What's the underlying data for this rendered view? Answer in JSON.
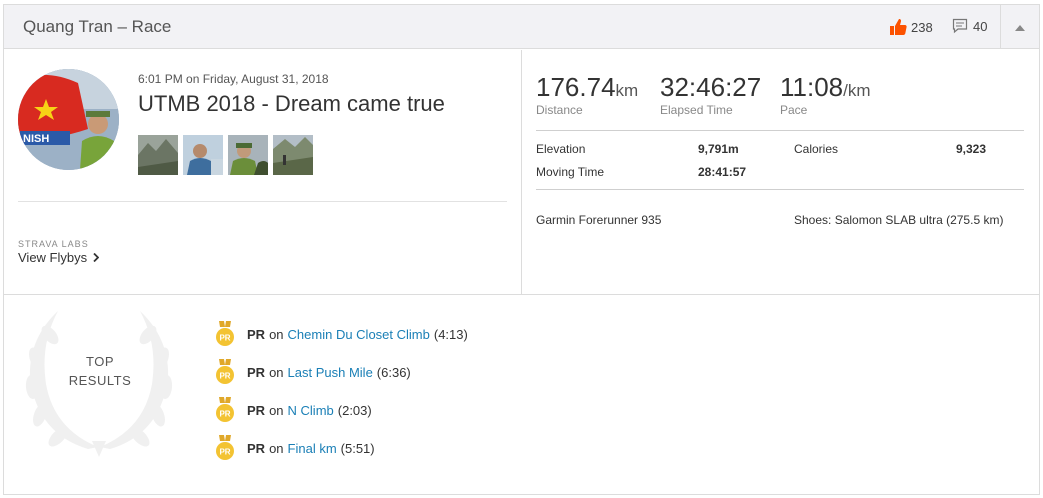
{
  "header": {
    "title": "Quang Tran – Race",
    "kudos_count": "238",
    "comments_count": "40"
  },
  "activity": {
    "datetime": "6:01 PM on Friday, August 31, 2018",
    "title": "UTMB 2018 - Dream came true",
    "labs_label": "STRAVA LABS",
    "flybys_label": "View Flybys"
  },
  "stats": {
    "distance": {
      "value": "176.74",
      "unit": "km",
      "label": "Distance"
    },
    "elapsed": {
      "value": "32:46:27",
      "label": "Elapsed Time"
    },
    "pace": {
      "value": "11:08",
      "unit": "/km",
      "label": "Pace"
    },
    "elevation_label": "Elevation",
    "elevation_value": "9,791m",
    "calories_label": "Calories",
    "calories_value": "9,323",
    "moving_label": "Moving Time",
    "moving_value": "28:41:57",
    "device": "Garmin Forerunner 935",
    "shoes": "Shoes: Salomon SLAB ultra (275.5 km)"
  },
  "top_results": {
    "line1": "TOP",
    "line2": "RESULTS",
    "items": [
      {
        "badge": "PR",
        "label": "PR",
        "on": "on",
        "segment": "Chemin Du Closet Climb",
        "time": "(4:13)"
      },
      {
        "badge": "PR",
        "label": "PR",
        "on": "on",
        "segment": "Last Push Mile",
        "time": "(6:36)"
      },
      {
        "badge": "PR",
        "label": "PR",
        "on": "on",
        "segment": "N Climb",
        "time": "(2:03)"
      },
      {
        "badge": "PR",
        "label": "PR",
        "on": "on",
        "segment": "Final km",
        "time": "(5:51)"
      }
    ]
  },
  "colors": {
    "accent_orange": "#fc5200",
    "link_blue": "#1a7fb6",
    "medal_gold": "#f3c332"
  }
}
